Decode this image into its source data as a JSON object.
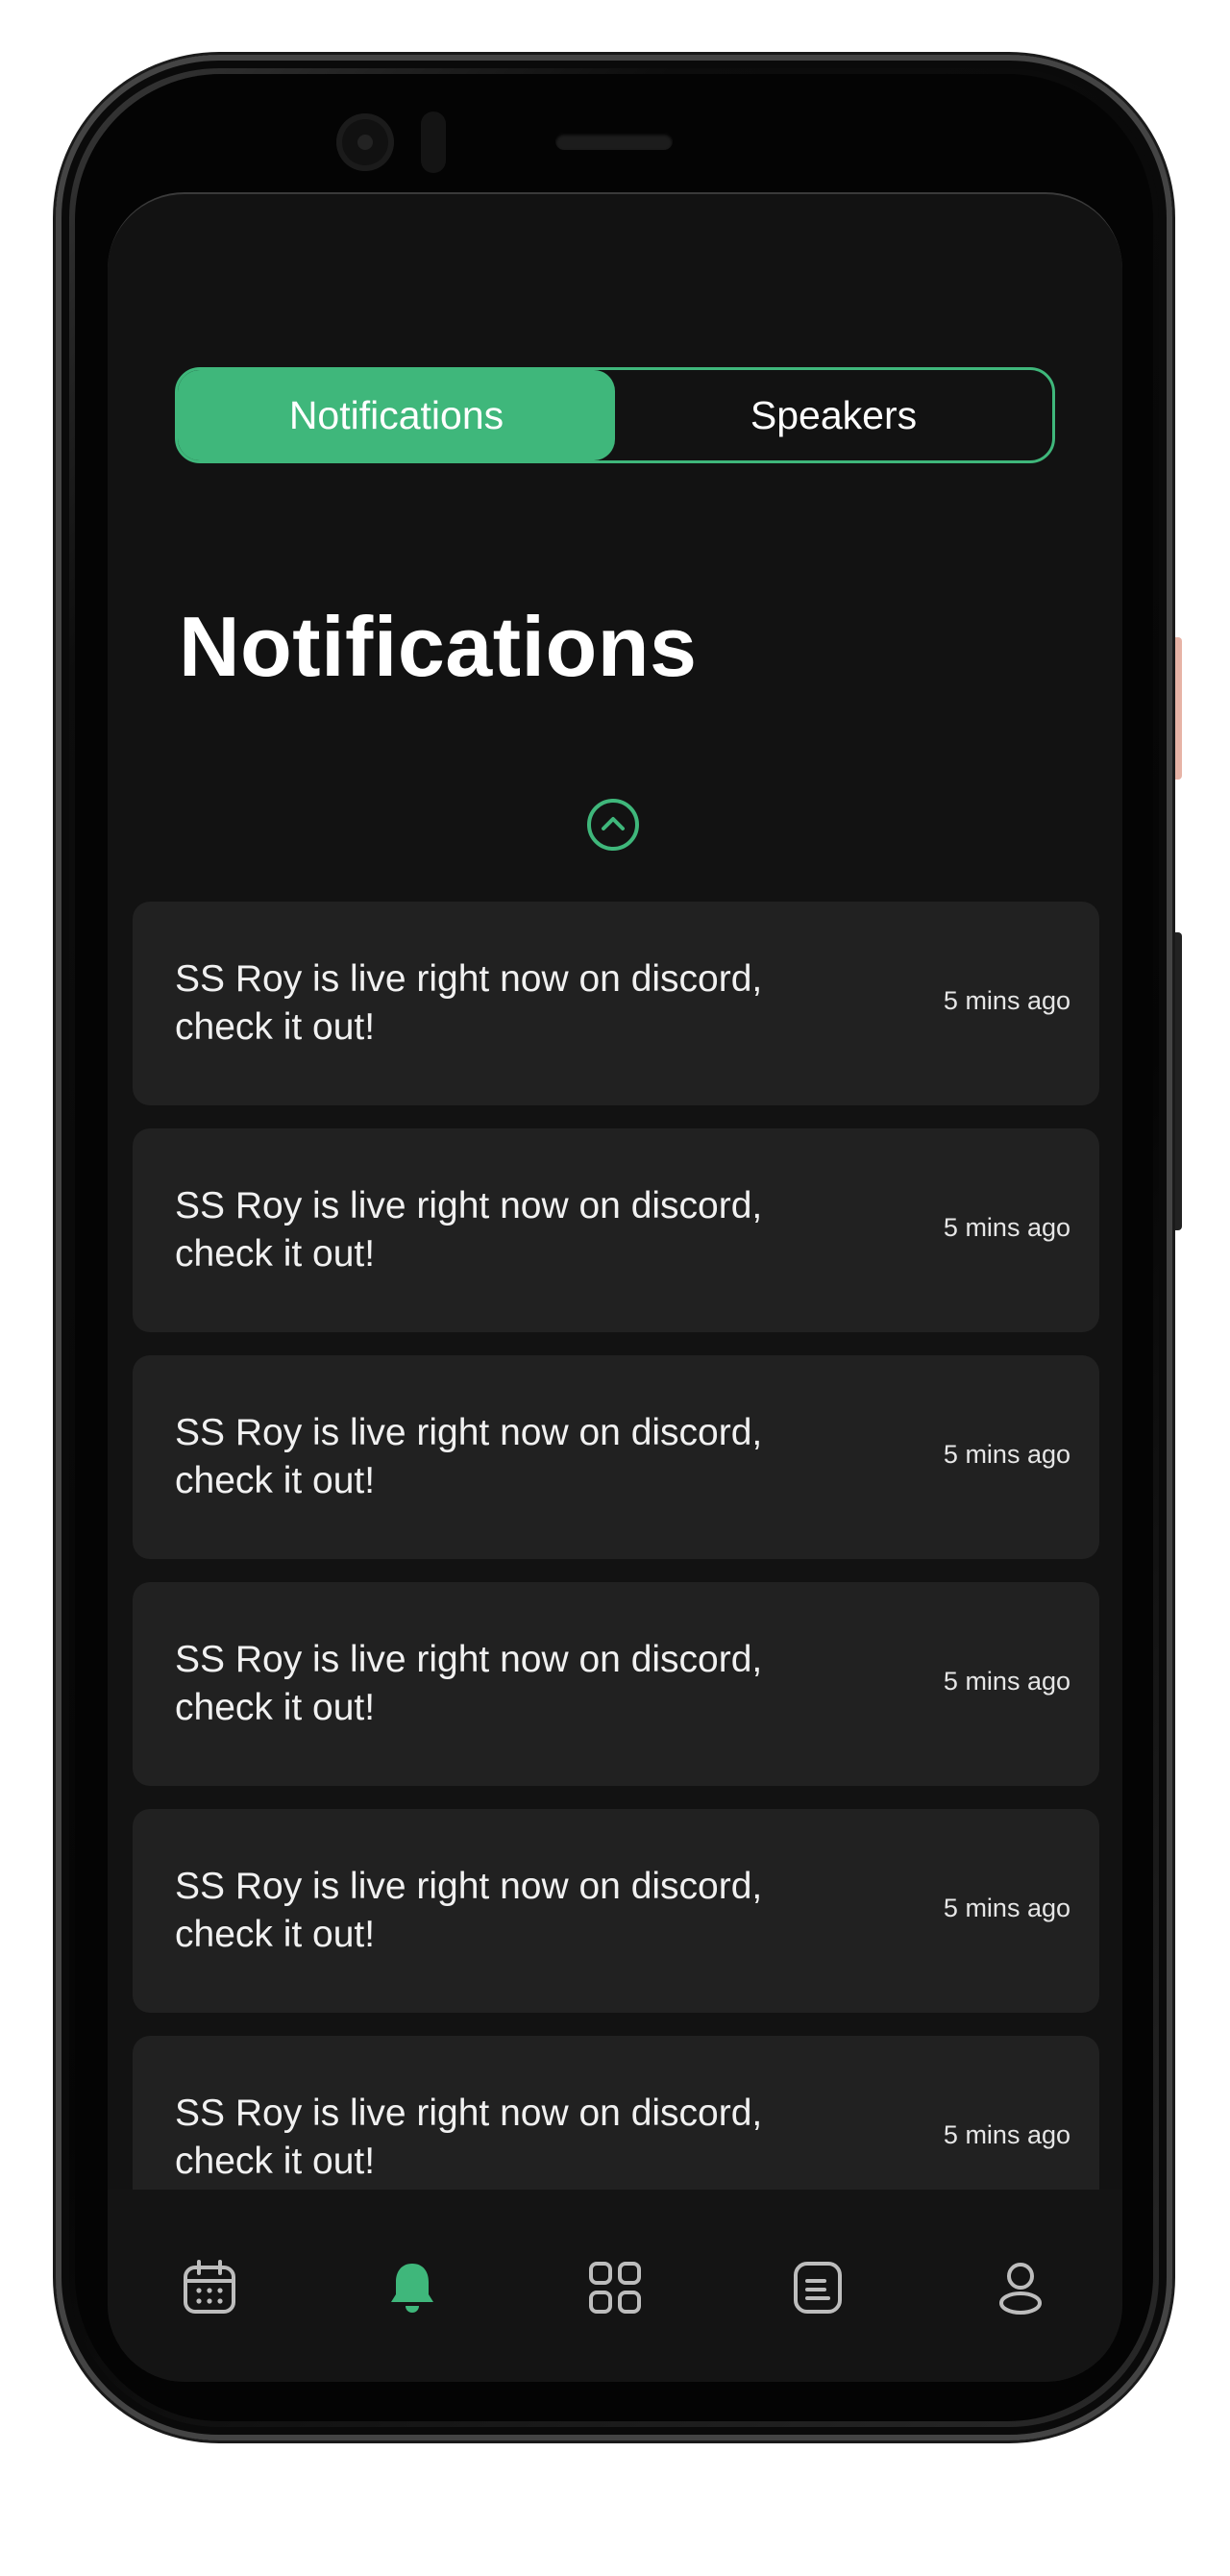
{
  "segmented_control": {
    "tabs": [
      {
        "label": "Notifications",
        "active": true
      },
      {
        "label": "Speakers",
        "active": false
      }
    ]
  },
  "page_title": "Notifications",
  "notifications": [
    {
      "text": "SS Roy is live right now on discord, check it out!",
      "time": "5 mins ago"
    },
    {
      "text": "SS Roy is live right now on discord, check it out!",
      "time": "5 mins ago"
    },
    {
      "text": "SS Roy is live right now on discord, check it out!",
      "time": "5 mins ago"
    },
    {
      "text": "SS Roy is live right now on discord, check it out!",
      "time": "5 mins ago"
    },
    {
      "text": "SS Roy is live right now on discord, check it out!",
      "time": "5 mins ago"
    },
    {
      "text": "SS Roy is live right now on discord, check it out!",
      "time": "5 mins ago"
    }
  ],
  "bottom_nav": {
    "items": [
      {
        "icon": "calendar-icon",
        "active": false
      },
      {
        "icon": "bell-icon",
        "active": true
      },
      {
        "icon": "grid-icon",
        "active": false
      },
      {
        "icon": "document-icon",
        "active": false
      },
      {
        "icon": "profile-icon",
        "active": false
      }
    ]
  },
  "colors": {
    "accent": "#3fb77b",
    "background": "#121212",
    "card": "#212121",
    "text": "#ffffff",
    "icon_inactive": "#bdbdbd"
  }
}
